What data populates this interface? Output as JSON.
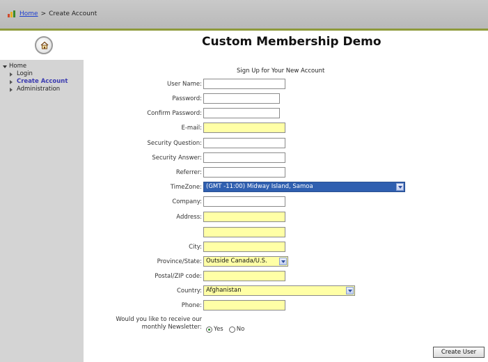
{
  "breadcrumb": {
    "home_link": "Home",
    "separator": ">",
    "current": "Create Account"
  },
  "header": {
    "title": "Custom Membership Demo"
  },
  "sidebar": {
    "root": "Home",
    "items": [
      {
        "label": "Login",
        "active": false
      },
      {
        "label": "Create Account",
        "active": true
      },
      {
        "label": "Administration",
        "active": false
      }
    ]
  },
  "form": {
    "heading": "Sign Up for Your New Account",
    "fields": {
      "username": {
        "label": "User Name:",
        "value": ""
      },
      "password": {
        "label": "Password:",
        "value": ""
      },
      "confirm_password": {
        "label": "Confirm Password:",
        "value": ""
      },
      "email": {
        "label": "E-mail:",
        "value": ""
      },
      "security_question": {
        "label": "Security Question:",
        "value": ""
      },
      "security_answer": {
        "label": "Security Answer:",
        "value": ""
      },
      "referrer": {
        "label": "Referrer:",
        "value": ""
      },
      "timezone": {
        "label": "TimeZone:",
        "value": "(GMT -11:00) Midway Island, Samoa"
      },
      "company": {
        "label": "Company:",
        "value": ""
      },
      "address": {
        "label": "Address:",
        "value": ""
      },
      "address2": {
        "value": ""
      },
      "city": {
        "label": "City:",
        "value": ""
      },
      "province": {
        "label": "Province/State:",
        "value": "Outside Canada/U.S."
      },
      "postal": {
        "label": "Postal/ZIP code:",
        "value": ""
      },
      "country": {
        "label": "Country:",
        "value": "Afghanistan"
      },
      "phone": {
        "label": "Phone:",
        "value": ""
      }
    },
    "newsletter": {
      "label_line1": "Would you like to receive our",
      "label_line2": "monthly Newsletter:",
      "yes": "Yes",
      "no": "No",
      "selected": "Yes"
    },
    "submit_label": "Create User"
  },
  "colors": {
    "required_field": "#ffffa6",
    "selected_select": "#2f5fb0",
    "sidebar_bg": "#d4d4d4",
    "topbar_accent": "#8e9a3a"
  }
}
